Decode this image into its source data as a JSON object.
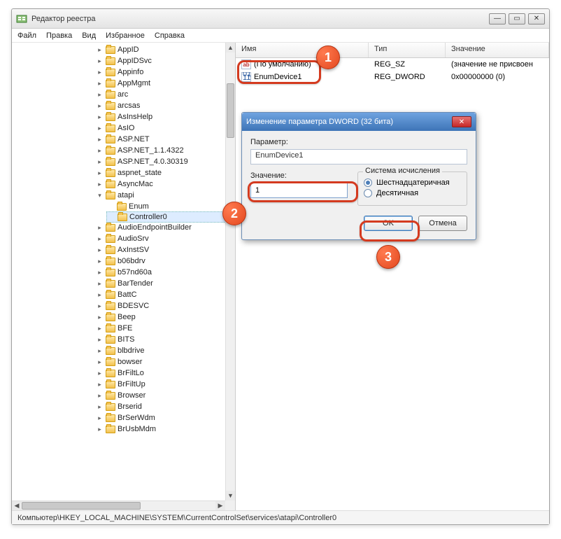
{
  "window": {
    "title": "Редактор реестра"
  },
  "menu": {
    "file": "Файл",
    "edit": "Правка",
    "view": "Вид",
    "favorites": "Избранное",
    "help": "Справка"
  },
  "tree": {
    "items": [
      "AppID",
      "AppIDSvc",
      "Appinfo",
      "AppMgmt",
      "arc",
      "arcsas",
      "AsInsHelp",
      "AsIO",
      "ASP.NET",
      "ASP.NET_1.1.4322",
      "ASP.NET_4.0.30319",
      "aspnet_state",
      "AsyncMac"
    ],
    "atapi": {
      "label": "atapi",
      "children": {
        "enum": "Enum",
        "controller0": "Controller0"
      }
    },
    "items2": [
      "AudioEndpointBuilder",
      "AudioSrv",
      "AxInstSV",
      "b06bdrv",
      "b57nd60a",
      "BarTender",
      "BattC",
      "BDESVC",
      "Beep",
      "BFE",
      "BITS",
      "blbdrive",
      "bowser",
      "BrFiltLo",
      "BrFiltUp",
      "Browser",
      "Brserid",
      "BrSerWdm",
      "BrUsbMdm"
    ]
  },
  "list": {
    "headers": {
      "name": "Имя",
      "type": "Тип",
      "data": "Значение"
    },
    "row_default": {
      "name": "(По умолчанию)",
      "type": "REG_SZ",
      "data": "(значение не присвоен"
    },
    "row_enum": {
      "name": "EnumDevice1",
      "type": "REG_DWORD",
      "data": "0x00000000 (0)"
    }
  },
  "dialog": {
    "title": "Изменение параметра DWORD (32 бита)",
    "param_label": "Параметр:",
    "param_value": "EnumDevice1",
    "value_label": "Значение:",
    "value_input": "1",
    "base_group": "Система исчисления",
    "radio_hex": "Шестнадцатеричная",
    "radio_dec": "Десятичная",
    "ok": "OK",
    "cancel": "Отмена"
  },
  "status": {
    "path": "Компьютер\\HKEY_LOCAL_MACHINE\\SYSTEM\\CurrentControlSet\\services\\atapi\\Controller0"
  },
  "badges": {
    "b1": "1",
    "b2": "2",
    "b3": "3"
  }
}
